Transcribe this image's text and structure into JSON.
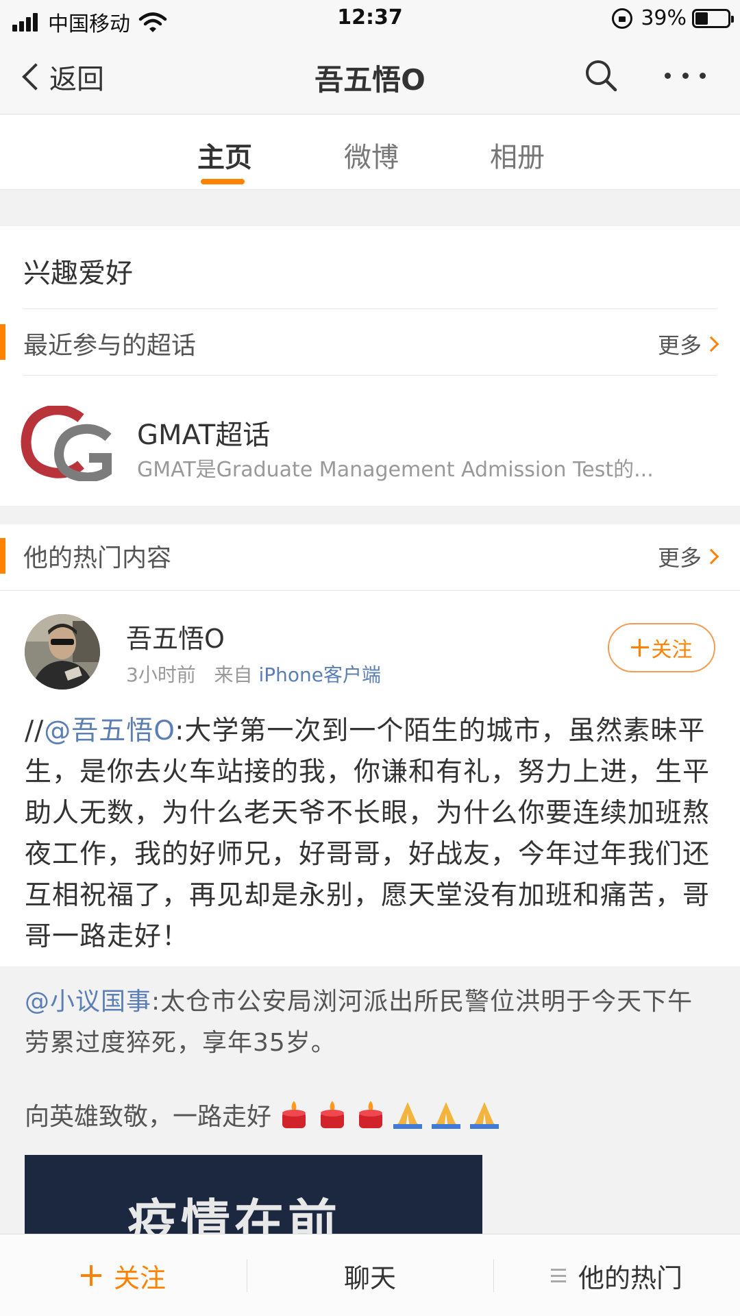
{
  "status_bar": {
    "carrier": "中国移动",
    "time": "12:37",
    "battery_percent": "39%",
    "battery_level": 0.39,
    "icons": [
      "signal-icon",
      "wifi-icon",
      "orientation-lock-icon",
      "battery-icon"
    ]
  },
  "nav": {
    "back_label": "返回",
    "title": "吾五悟O",
    "icons": [
      "back-chevron-icon",
      "search-icon",
      "more-icon"
    ]
  },
  "tabs": [
    {
      "label": "主页",
      "active": true
    },
    {
      "label": "微博",
      "active": false
    },
    {
      "label": "相册",
      "active": false
    }
  ],
  "interests": {
    "title": "兴趣爱好",
    "section_label": "最近参与的超话",
    "more_label": "更多",
    "topic": {
      "title": "GMAT超话",
      "description": "GMAT是Graduate Management Admission Test的...",
      "logo": "gmat-cg-logo"
    }
  },
  "hot": {
    "section_label": "他的热门内容",
    "more_label": "更多",
    "post": {
      "author": "吾五悟O",
      "time": "3小时前",
      "from_prefix": "来自",
      "source": "iPhone客户端",
      "follow_label": "关注",
      "text_prefix": "//",
      "mention": "@吾五悟O",
      "text": ":大学第一次到一个陌生的城市，虽然素昧平生，是你去火车站接的我，你谦和有礼，努力上进，生平助人无数，为什么老天爷不长眼，为什么你要连续加班熬夜工作，我的好师兄，好哥哥，好战友，今年过年我们还互相祝福了，再见却是永别，愿天堂没有加班和痛苦，哥哥一路走好！",
      "repost": {
        "mention": "@小议国事",
        "text": ":太仓市公安局浏河派出所民警位洪明于今天下午劳累过度猝死，享年35岁。",
        "tribute": "向英雄致敬，一路走好",
        "image_text": "疫情在前"
      }
    }
  },
  "bottom_bar": {
    "follow_label": "关注",
    "chat_label": "聊天",
    "hot_label": "他的热门"
  },
  "colors": {
    "accent": "#ff8200",
    "link": "#5b7fb5",
    "background_gap": "#f2f2f2"
  }
}
